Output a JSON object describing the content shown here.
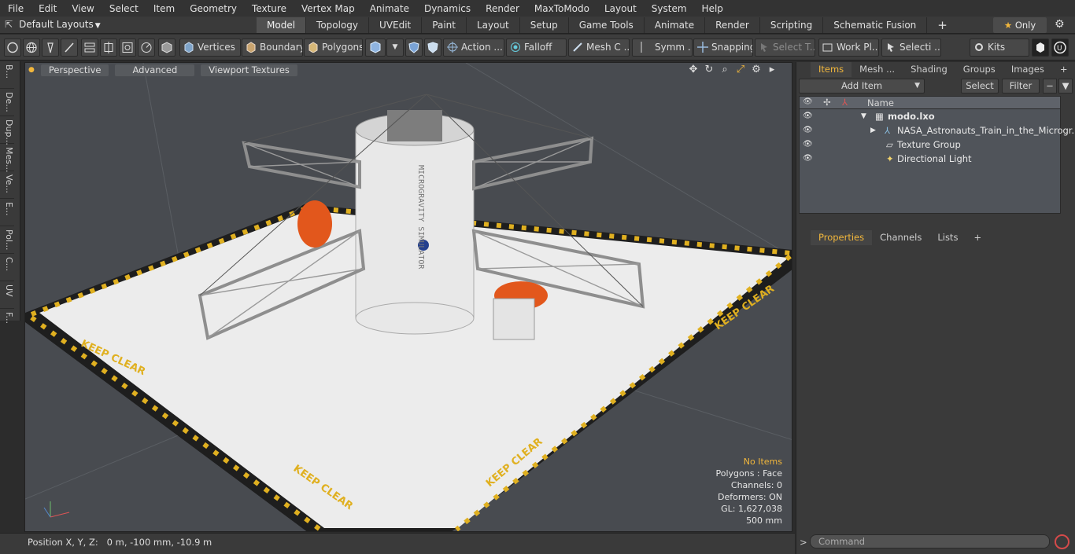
{
  "menu": [
    "File",
    "Edit",
    "View",
    "Select",
    "Item",
    "Geometry",
    "Texture",
    "Vertex Map",
    "Animate",
    "Dynamics",
    "Render",
    "MaxToModo",
    "Layout",
    "System",
    "Help"
  ],
  "layout_selector": "Default Layouts",
  "tabs": [
    "Model",
    "Topology",
    "UVEdit",
    "Paint",
    "Layout",
    "Setup",
    "Game Tools",
    "Animate",
    "Render",
    "Scripting",
    "Schematic Fusion"
  ],
  "active_tab": "Model",
  "only_label": "Only",
  "toolbar": {
    "vertices": "Vertices",
    "boundary": "Boundary",
    "polygons": "Polygons",
    "action": "Action ...",
    "falloff": "Falloff",
    "mesh": "Mesh C ...",
    "symm": "Symm ...",
    "snapping": "Snapping",
    "select_t": "Select T...",
    "work_pl": "Work Pl...",
    "selecti": "Selecti ...",
    "kits": "Kits"
  },
  "left_strip": [
    "B...",
    "De...",
    "Dup...",
    "Mes...",
    "Ve...",
    "E...",
    "Pol...",
    "C...",
    "UV",
    "F..."
  ],
  "viewport": {
    "perspective": "Perspective",
    "advanced": "Advanced",
    "textures": "Viewport Textures",
    "stats": {
      "no_items": "No Items",
      "polygons": "Polygons : Face",
      "channels": "Channels: 0",
      "deformers": "Deformers: ON",
      "gl": "GL: 1,627,038",
      "size": "500 mm"
    },
    "floor_text": "KEEP CLEAR",
    "tower_text": "MICROGRAVITY SIMULATOR"
  },
  "status": "Position X, Y, Z:   0 m, -100 mm, -10.9 m",
  "right_tabs": [
    "Items",
    "Mesh ...",
    "Shading",
    "Groups",
    "Images"
  ],
  "add_item": "Add Item",
  "select_btn": "Select",
  "filter_btn": "Filter",
  "tree_header": "Name",
  "tree": [
    {
      "label": "modo.lxo",
      "bold": true
    },
    {
      "label": "NASA_Astronauts_Train_in_the_Microgr..."
    },
    {
      "label": "Texture Group"
    },
    {
      "label": "Directional Light"
    }
  ],
  "prop_tabs": [
    "Properties",
    "Channels",
    "Lists"
  ],
  "command_placeholder": "Command",
  "colors": {
    "accent": "#f2b73c",
    "floor": "#ececec",
    "hazard": "#1e1e1e"
  }
}
